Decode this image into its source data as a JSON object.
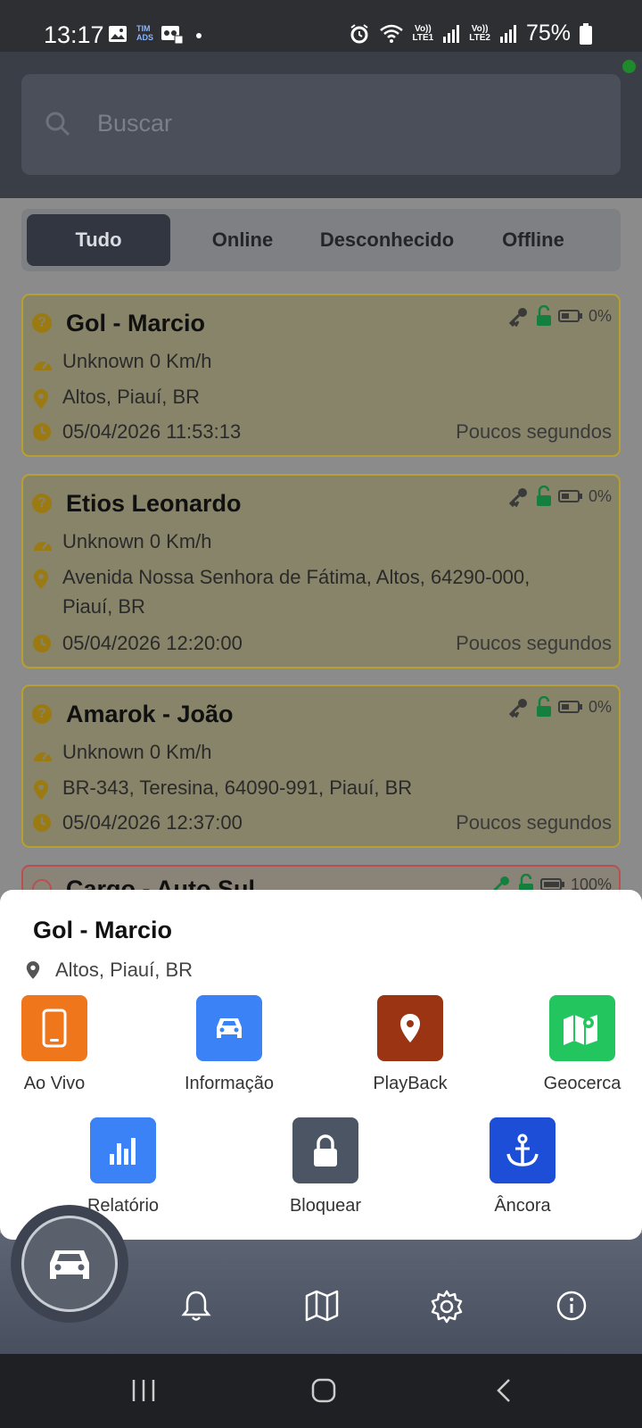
{
  "status_bar": {
    "time": "13:17",
    "carrier_small": "TIM\nADS",
    "lte1": "Vo))\nLTE1",
    "lte2": "Vo))\nLTE2",
    "battery": "75%"
  },
  "search": {
    "placeholder": "Buscar"
  },
  "tabs": [
    {
      "label": "Tudo",
      "active": true
    },
    {
      "label": "Online",
      "active": false
    },
    {
      "label": "Desconhecido",
      "active": false
    },
    {
      "label": "Offline",
      "active": false
    }
  ],
  "vehicles": [
    {
      "name": "Gol - Marcio",
      "speed": "Unknown 0 Km/h",
      "address": "Altos, Piauí, BR",
      "datetime": "05/04/2026 11:53:13",
      "ago": "Poucos segundos",
      "battery": "0%"
    },
    {
      "name": "Etios Leonardo",
      "speed": "Unknown 0 Km/h",
      "address": "Avenida Nossa Senhora de Fátima, Altos, 64290-000,",
      "address2": "Piauí, BR",
      "datetime": "05/04/2026 12:20:00",
      "ago": "Poucos segundos",
      "battery": "0%"
    },
    {
      "name": "Amarok - João",
      "speed": "Unknown 0 Km/h",
      "address": "BR-343, Teresina, 64090-991, Piauí, BR",
      "datetime": "05/04/2026 12:37:00",
      "ago": "Poucos segundos",
      "battery": "0%"
    },
    {
      "name": "Cargo - Auto Sul",
      "battery": "100%"
    }
  ],
  "sheet": {
    "title": "Gol - Marcio",
    "address": "Altos, Piauí, BR",
    "actions": [
      {
        "label": "Ao Vivo",
        "icon": "phone-icon",
        "color": "#f0761c"
      },
      {
        "label": "Informação",
        "icon": "car-icon",
        "color": "#3b82f6"
      },
      {
        "label": "PlayBack",
        "icon": "location-pin-icon",
        "color": "#9a3412"
      },
      {
        "label": "Geocerca",
        "icon": "map-icon",
        "color": "#22c55e"
      },
      {
        "label": "Relatório",
        "icon": "bar-chart-icon",
        "color": "#3b82f6"
      },
      {
        "label": "Bloquear",
        "icon": "lock-icon",
        "color": "#4b5563"
      },
      {
        "label": "Âncora",
        "icon": "anchor-icon",
        "color": "#1d4ed8"
      }
    ]
  },
  "colors": {
    "card_yellow_border": "#b7a032",
    "card_red_border": "#b85050",
    "unlock_green": "#15803d"
  }
}
